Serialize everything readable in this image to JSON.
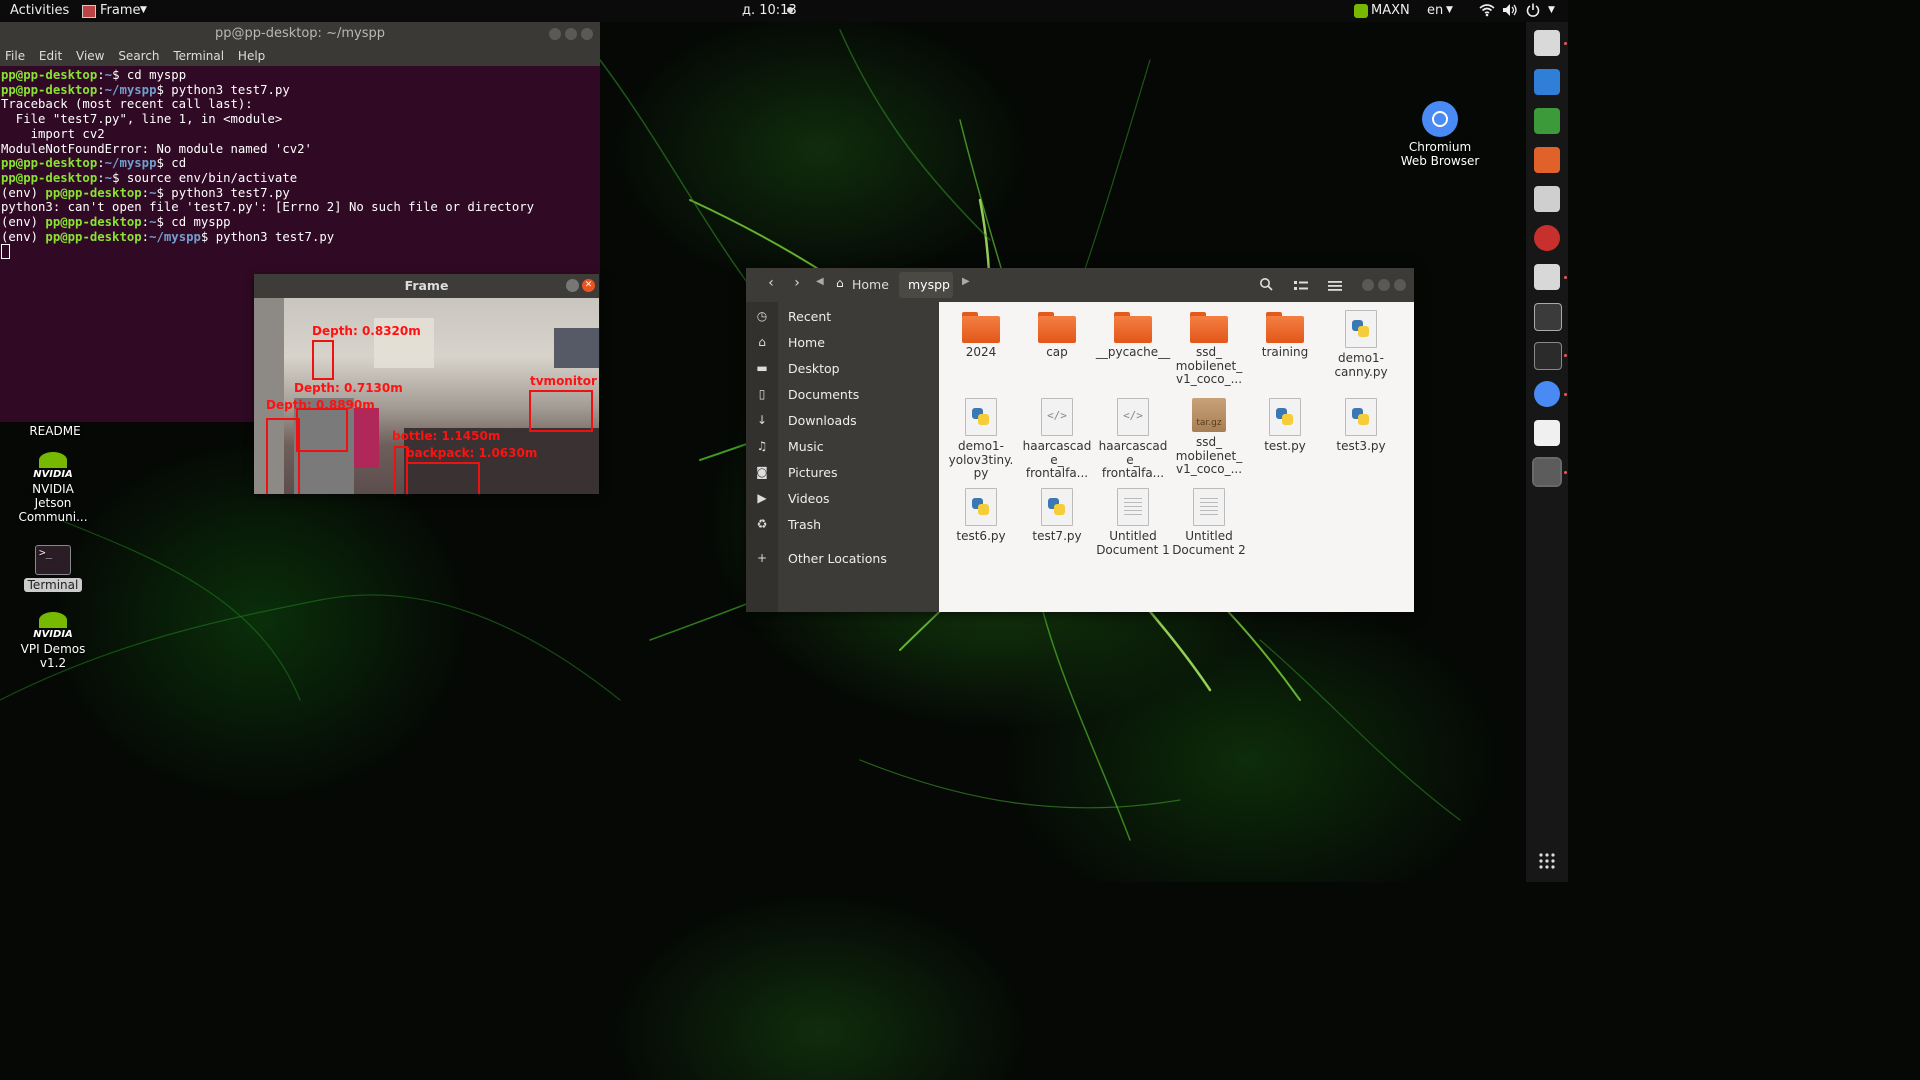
{
  "topbar": {
    "activities": "Activities",
    "app_menu": "Frame",
    "clock": "д. 10:13",
    "power_mode": "MAXN",
    "language": "en"
  },
  "terminal": {
    "title": "pp@pp-desktop: ~/myspp",
    "menu": [
      "File",
      "Edit",
      "View",
      "Search",
      "Terminal",
      "Help"
    ],
    "lines": [
      {
        "env": "",
        "user": "pp@pp-desktop",
        "path": "~",
        "cmd": "$ cd myspp"
      },
      {
        "env": "",
        "user": "pp@pp-desktop",
        "path": "~/myspp",
        "cmd": "$ python3 test7.py"
      },
      {
        "text": "Traceback (most recent call last):"
      },
      {
        "text": "  File \"test7.py\", line 1, in <module>"
      },
      {
        "text": "    import cv2"
      },
      {
        "text": "ModuleNotFoundError: No module named 'cv2'"
      },
      {
        "env": "",
        "user": "pp@pp-desktop",
        "path": "~/myspp",
        "cmd": "$ cd"
      },
      {
        "env": "",
        "user": "pp@pp-desktop",
        "path": "~",
        "cmd": "$ source env/bin/activate"
      },
      {
        "env": "(env) ",
        "user": "pp@pp-desktop",
        "path": "~",
        "cmd": "$ python3 test7.py"
      },
      {
        "text": "python3: can't open file 'test7.py': [Errno 2] No such file or directory"
      },
      {
        "env": "(env) ",
        "user": "pp@pp-desktop",
        "path": "~",
        "cmd": "$ cd myspp"
      },
      {
        "env": "(env) ",
        "user": "pp@pp-desktop",
        "path": "~/myspp",
        "cmd": "$ python3 test7.py"
      }
    ]
  },
  "frame_window": {
    "title": "Frame",
    "detections": [
      {
        "label": "Depth: 0.8320m"
      },
      {
        "label": "Depth: 0.7130m"
      },
      {
        "label": "Depth: 0.8890m"
      },
      {
        "label": "tvmonitor"
      },
      {
        "label": "bottle: 1.1450m"
      },
      {
        "label": "backpack: 1.0630m"
      }
    ]
  },
  "file_manager": {
    "path_home": "Home",
    "path_current": "myspp",
    "sidebar": [
      {
        "label": "Recent",
        "icon": "clock-icon"
      },
      {
        "label": "Home",
        "icon": "home-icon"
      },
      {
        "label": "Desktop",
        "icon": "folder-icon"
      },
      {
        "label": "Documents",
        "icon": "document-icon"
      },
      {
        "label": "Downloads",
        "icon": "download-icon"
      },
      {
        "label": "Music",
        "icon": "music-icon"
      },
      {
        "label": "Pictures",
        "icon": "camera-icon"
      },
      {
        "label": "Videos",
        "icon": "video-icon"
      },
      {
        "label": "Trash",
        "icon": "trash-icon"
      },
      {
        "label": "Other Locations",
        "icon": "plus-icon"
      }
    ],
    "items": [
      {
        "name": "2024",
        "kind": "folder"
      },
      {
        "name": "cap",
        "kind": "folder"
      },
      {
        "name": "__pycache__",
        "kind": "folder"
      },
      {
        "name": "ssd_ mobilenet_ v1_coco_...",
        "kind": "folder"
      },
      {
        "name": "training",
        "kind": "folder"
      },
      {
        "name": "demo1- canny.py",
        "kind": "python"
      },
      {
        "name": "demo1- yolov3tiny. py",
        "kind": "python"
      },
      {
        "name": "haarcascad e_ frontalfa...",
        "kind": "xml"
      },
      {
        "name": "haarcascad e_ frontalfa...",
        "kind": "xml"
      },
      {
        "name": "ssd_ mobilenet_ v1_coco_...",
        "kind": "archive",
        "badge": "tar.gz"
      },
      {
        "name": "test.py",
        "kind": "python"
      },
      {
        "name": "test3.py",
        "kind": "python"
      },
      {
        "name": "test6.py",
        "kind": "python"
      },
      {
        "name": "test7.py",
        "kind": "python"
      },
      {
        "name": "Untitled Document 1",
        "kind": "text"
      },
      {
        "name": "Untitled Document 2",
        "kind": "text"
      }
    ]
  },
  "desktop": {
    "readme": "README",
    "nvidia_logo": "NVIDIA",
    "jetson_community": "NVIDIA Jetson Communi...",
    "terminal": "Terminal",
    "vpi_demos": "VPI Demos v1.2",
    "chromium": "Chromium Web Browser"
  }
}
